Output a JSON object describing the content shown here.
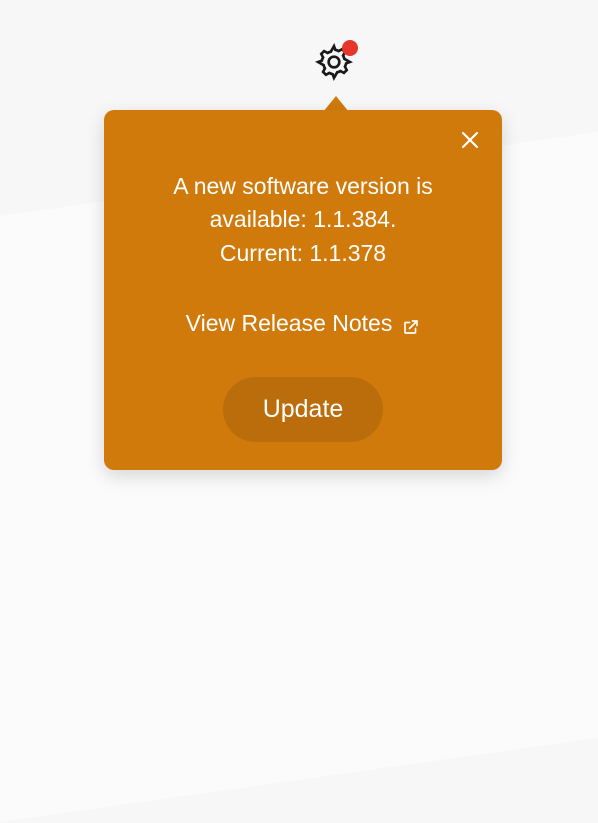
{
  "popover": {
    "message_line1": "A new software version is",
    "message_line2": "available: 1.1.384.",
    "message_line3": "Current: 1.1.378",
    "release_notes_label": "View Release Notes",
    "update_label": "Update"
  },
  "colors": {
    "popover_bg": "#d07a0c",
    "notify_dot": "#e5382a"
  }
}
